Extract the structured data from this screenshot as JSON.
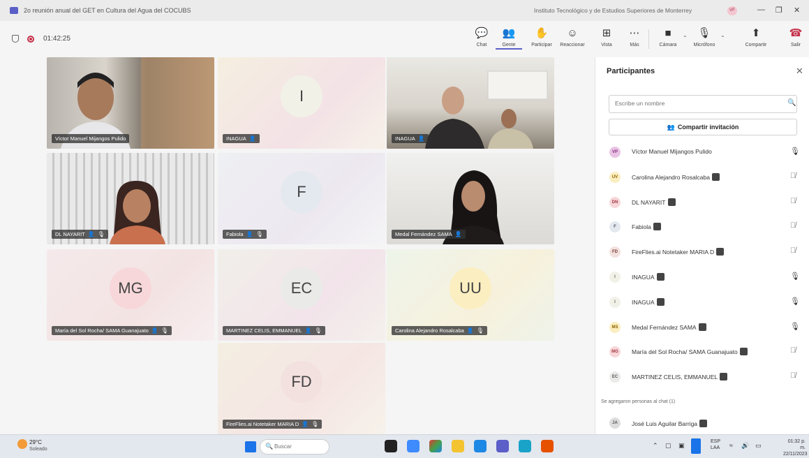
{
  "window": {
    "title": "2o reunión anual del GET en Cultura del Agua del COCUBS",
    "org": "Instituto Tecnológico y de Estudios Superiores de Monterrey",
    "user_initials": "VF",
    "minimize": "—",
    "restore": "❐",
    "close": "✕"
  },
  "meeting": {
    "timer": "01:42:25"
  },
  "toolbar": {
    "chat": "Chat",
    "people": "Gente",
    "raise": "Participar",
    "react": "Reaccionar",
    "view": "Vista",
    "more": "Más",
    "camera": "Cámara",
    "mic": "Micrófono",
    "share": "Compartir",
    "leave": "Salir"
  },
  "tiles": [
    {
      "name": "Víctor Manuel Mijangos Pulido",
      "type": "video"
    },
    {
      "name": "INAGUA",
      "type": "initials",
      "initials": "I",
      "circle": "#f1f1e8",
      "text": "#444"
    },
    {
      "name": "INAGUA",
      "type": "video"
    },
    {
      "name": "DL NAYARIT",
      "type": "video"
    },
    {
      "name": "Fabiola",
      "type": "initials",
      "initials": "F",
      "circle": "#e4e9ef",
      "text": "#444"
    },
    {
      "name": "Medal Fernández SAMA",
      "type": "video"
    },
    {
      "name": "María del Sol Rocha/ SAMA Guanajuato",
      "type": "initials",
      "initials": "MG",
      "circle": "#f7d7d9",
      "text": "#444"
    },
    {
      "name": "MARTINEZ CELIS, EMMANUEL",
      "type": "initials",
      "initials": "EC",
      "circle": "#eaebe8",
      "text": "#444"
    },
    {
      "name": "Carolina Alejandro Rosalcaba",
      "type": "initials",
      "initials": "UU",
      "circle": "#fbeec0",
      "text": "#444"
    },
    {
      "name": "FireFlies.ai Notetaker MARIA D",
      "type": "initials",
      "initials": "FD",
      "circle": "#f3e1df",
      "text": "#444"
    }
  ],
  "panel": {
    "title": "Participantes",
    "search_placeholder": "Escribe un nombre",
    "share_invite": "Compartir invitación",
    "participants": [
      {
        "initials": "VP",
        "name": "Víctor Manuel Mijangos Pulido",
        "badge": false,
        "mic": "on",
        "color": "#e9c3e4",
        "fg": "#8a2f80"
      },
      {
        "initials": "UV",
        "name": "Carolina Alejandro Rosalcaba",
        "badge": true,
        "mic": "off",
        "color": "#fbeec0",
        "fg": "#8a6300"
      },
      {
        "initials": "DN",
        "name": "DL NAYARIT",
        "badge": true,
        "mic": "off",
        "color": "#f7d7d9",
        "fg": "#a33a47"
      },
      {
        "initials": "F",
        "name": "Fabiola",
        "badge": true,
        "mic": "off",
        "color": "#e4e9ef",
        "fg": "#556"
      },
      {
        "initials": "FD",
        "name": "FireFlies.ai Notetaker MARIA D",
        "badge": true,
        "mic": "off",
        "color": "#f3e1df",
        "fg": "#7a3b33"
      },
      {
        "initials": "I",
        "name": "INAGUA",
        "badge": true,
        "mic": "on",
        "color": "#f1f1e8",
        "fg": "#666"
      },
      {
        "initials": "I",
        "name": "INAGUA",
        "badge": true,
        "mic": "on",
        "color": "#f1f1e8",
        "fg": "#666"
      },
      {
        "initials": "MS",
        "name": "Medal Fernández SAMA",
        "badge": true,
        "mic": "on",
        "color": "#fbeec0",
        "fg": "#8a6300"
      },
      {
        "initials": "MG",
        "name": "María del Sol Rocha/ SAMA Guanajuato",
        "badge": true,
        "mic": "off",
        "color": "#f7d7d9",
        "fg": "#a33a47"
      },
      {
        "initials": "EC",
        "name": "MARTINEZ CELIS, EMMANUEL",
        "badge": true,
        "mic": "off",
        "color": "#eaebe8",
        "fg": "#555"
      }
    ],
    "group_label": "Se agregaron personas al chat (1)",
    "guest": {
      "initials": "JA",
      "name": "José Luis Aguilar Barriga"
    }
  },
  "taskbar": {
    "temp": "29°C",
    "condition": "Soleado",
    "search_placeholder": "Buscar",
    "lang1": "ESP",
    "lang2": "LAA",
    "time": "01:32 p. m.",
    "date": "22/11/2023"
  }
}
